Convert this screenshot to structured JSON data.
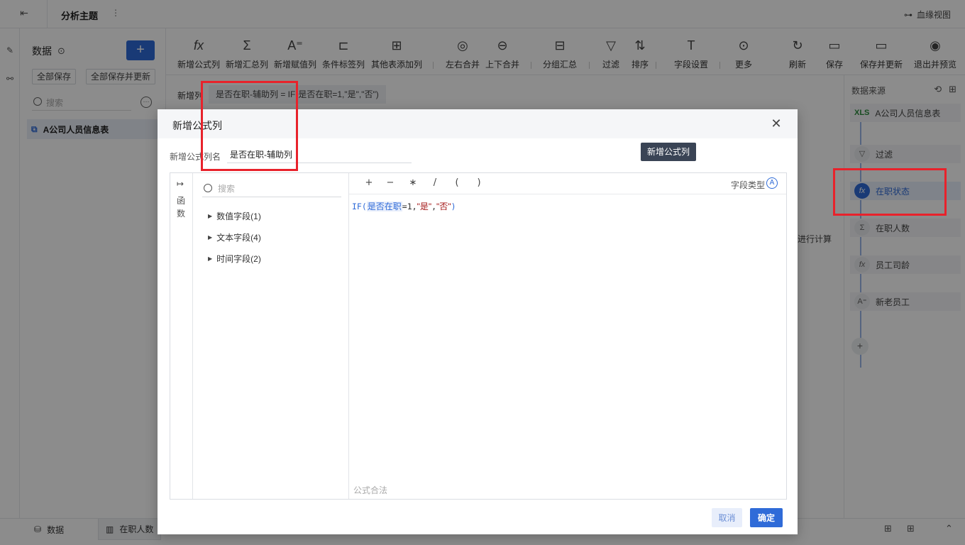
{
  "topbar": {
    "title": "分析主题",
    "lineage_label": "血缘视图"
  },
  "data_panel": {
    "header": "数据",
    "add_label": "+",
    "save_all": "全部保存",
    "save_all_update": "全部保存并更新",
    "search_placeholder": "搜索",
    "tables": [
      "A公司人员信息表"
    ]
  },
  "toolbar": {
    "items": [
      "新增公式列",
      "新增汇总列",
      "新增赋值列",
      "条件标签列",
      "其他表添加列",
      "左右合并",
      "上下合并",
      "分组汇总",
      "过滤",
      "排序",
      "字段设置",
      "更多",
      "刷新",
      "保存",
      "保存并更新",
      "退出并预览"
    ]
  },
  "workarea": {
    "label": "新增列",
    "formula_preview": "是否在职-辅助列 = IF(是否在职=1,\"是\",\"否\")",
    "calc_text": "进行计算"
  },
  "right_panel": {
    "header": "数据来源",
    "nodes": [
      {
        "label": "A公司人员信息表",
        "icon": "xls-icon"
      },
      {
        "label": "过滤",
        "icon": "filter-icon"
      },
      {
        "label": "在职状态",
        "icon": "fx-icon"
      },
      {
        "label": "在职人数",
        "icon": "sigma-icon"
      },
      {
        "label": "员工司龄",
        "icon": "fx-icon"
      },
      {
        "label": "新老员工",
        "icon": "assign-icon"
      }
    ],
    "add_label": "+"
  },
  "bottombar": {
    "tabs": [
      "数据",
      "在职人数"
    ]
  },
  "dialog": {
    "title": "新增公式列",
    "name_label": "新增公式列名",
    "name_value": "是否在职-辅助列",
    "tooltip": "新增公式列",
    "rail_arrow": "↦",
    "rail_label": "函数",
    "field_search_placeholder": "搜索",
    "field_groups": [
      "数值字段(1)",
      "文本字段(4)",
      "时间字段(2)"
    ],
    "operators": [
      "+",
      "−",
      "∗",
      "/",
      "(",
      ")"
    ],
    "field_type_label": "字段类型",
    "field_type_icon": "Ⓐ",
    "formula": {
      "fn": "IF(",
      "field": "是否在职",
      "cond": "=1,",
      "v1": "\"是\"",
      "comma": ",",
      "v2": "\"否\"",
      "close": ")"
    },
    "status": "公式合法",
    "cancel": "取消",
    "ok": "确定"
  },
  "colors": {
    "primary": "#2f6bd8",
    "highlight": "#e8222b",
    "tooltip_bg": "#3a4455"
  }
}
